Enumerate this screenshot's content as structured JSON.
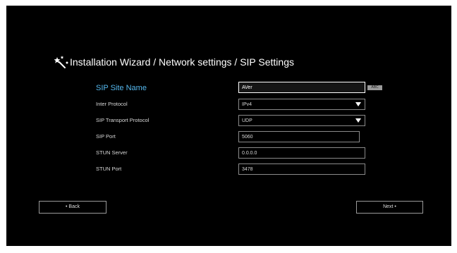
{
  "header": {
    "title": "Installation Wizard / Network settings / SIP Settings",
    "icon": "wand-sparkle-icon"
  },
  "form": {
    "site_name": {
      "label": "SIP Site Name",
      "value": "AVer",
      "badge": "ABC"
    },
    "inter_protocol": {
      "label": "Inter Protocol",
      "value": "IPv4"
    },
    "transport_protocol": {
      "label": "SIP Transport Protocol",
      "value": "UDP"
    },
    "sip_port": {
      "label": "SIP Port",
      "value": "5060"
    },
    "stun_server": {
      "label": "STUN Server",
      "value": "0.0.0.0"
    },
    "stun_port": {
      "label": "STUN Port",
      "value": "3478"
    }
  },
  "nav": {
    "back_label": "• Back",
    "next_label": "Next •"
  },
  "colors": {
    "background": "#000000",
    "active_label": "#55b8ee",
    "text": "#d8d8d8",
    "border": "#8a8a8a"
  }
}
